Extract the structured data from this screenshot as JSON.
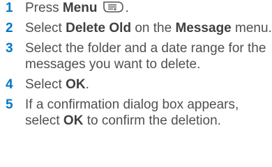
{
  "steps": [
    {
      "number": "1",
      "parts": [
        "Press ",
        "Menu",
        ""
      ],
      "icon": "menu-button-icon"
    },
    {
      "number": "2",
      "parts": [
        "Select ",
        "Delete Old",
        " on the ",
        "Message",
        " menu."
      ]
    },
    {
      "number": "3",
      "parts": [
        "Select the folder and a date range for the messages you want to delete."
      ]
    },
    {
      "number": "4",
      "parts": [
        "Select ",
        "OK",
        "."
      ]
    },
    {
      "number": "5",
      "parts": [
        "If a confirmation dialog box appears, select ",
        "OK",
        " to confirm the deletion."
      ]
    }
  ],
  "step1_suffix": "."
}
